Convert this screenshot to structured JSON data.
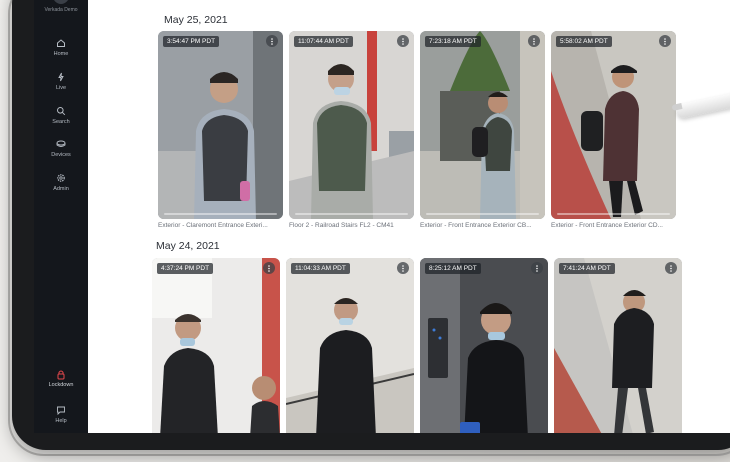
{
  "org": {
    "name": "Verkada Demo"
  },
  "sidebar": {
    "items": [
      {
        "label": "Home",
        "icon": "home-icon"
      },
      {
        "label": "Live",
        "icon": "live-icon"
      },
      {
        "label": "Search",
        "icon": "search-icon"
      },
      {
        "label": "Devices",
        "icon": "devices-icon"
      },
      {
        "label": "Admin",
        "icon": "admin-icon"
      }
    ],
    "lockdown": {
      "label": "Lockdown",
      "icon": "lock-icon",
      "color": "#e5484d"
    },
    "help": {
      "label": "Help",
      "icon": "help-icon"
    }
  },
  "sections": [
    {
      "date": "May 25, 2021",
      "cards": [
        {
          "timestamp": "3:54:47 PM PDT",
          "caption": "Exterior - Claremont Entrance Exteri...",
          "progress": 0.9
        },
        {
          "timestamp": "11:07:44 AM PDT",
          "caption": "Floor 2 - Railroad Stairs FL2 - CM41",
          "progress": 0.9
        },
        {
          "timestamp": "7:23:18 AM PDT",
          "caption": "Exterior - Front Entrance Exterior CB...",
          "progress": 0.9
        },
        {
          "timestamp": "5:58:02 AM PDT",
          "caption": "Exterior - Front Entrance Exterior CD...",
          "progress": 0.9
        }
      ]
    },
    {
      "date": "May 24, 2021",
      "cards": [
        {
          "timestamp": "4:37:24 PM PDT"
        },
        {
          "timestamp": "11:04:33 AM PDT"
        },
        {
          "timestamp": "8:25:12 AM PDT"
        },
        {
          "timestamp": "7:41:24 AM PDT"
        }
      ]
    }
  ]
}
